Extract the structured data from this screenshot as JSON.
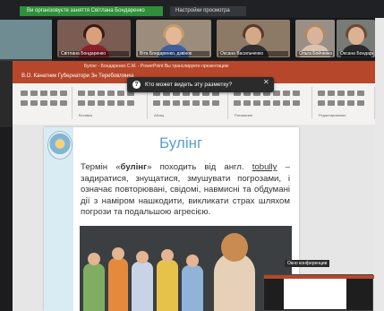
{
  "meeting": {
    "banner_title": "Ви організовуєте заняття Світлана Бондаренко",
    "view_settings": "Настройки просмотра",
    "participants": [
      {
        "name": "Світлана Бондаренко",
        "bg": "#7a5c52",
        "face": "#d9a07e",
        "hair": "#3a1a12",
        "shirt": "#8c1f2a"
      },
      {
        "name": "Віта Бондаренко, дзвінок",
        "bg": "#9b8c7b",
        "face": "#e5b796",
        "hair": "#c69b6b",
        "shirt": "#3f5fa1"
      },
      {
        "name": "Оксана Васильченко",
        "bg": "#8d7a66",
        "face": "#d4a98a",
        "hair": "#5b3a26",
        "shirt": "#2e2e34"
      },
      {
        "name": "Ольга Бойченко",
        "bg": "#9a8f86",
        "face": "#d9b39a",
        "hair": "#b08a62",
        "shirt": "#d8c3b0"
      },
      {
        "name": "Оксана Бондаренко",
        "bg": "#777a76",
        "face": "#dcb294",
        "hair": "#6b4a2f",
        "shirt": "#2a2a2a"
      }
    ]
  },
  "powerpoint": {
    "title": "Булінг - Бондаренко С.М. - PowerPoint Вы транслируете презентацию",
    "tab_label": "В.О. Канатник Губернатори Зн Теребовлянка",
    "tooltip": "Кто может видеть эту разметку?",
    "ribbon_labels": [
      "Вставка",
      "Абзац",
      "Рисование",
      "Редактирование"
    ]
  },
  "slide": {
    "title": "Булінг",
    "body_pre": "Термін «",
    "body_term": "булінг",
    "body_mid": "» походить від англ. ",
    "body_link": "tobully",
    "body_post": " – задиратися, знущатися, змушувати погрозами, і означає повторювані, свідомі, навмисні та обдумані дії з наміром нашкодити, викликати страх шляхом погрози та подальшою агресією."
  },
  "mini_window": {
    "label": "Окно конференции"
  },
  "colors": {
    "accent_ppt": "#b7472a",
    "banner_green": "#2f8f3a",
    "slide_title": "#5aa0cf"
  }
}
